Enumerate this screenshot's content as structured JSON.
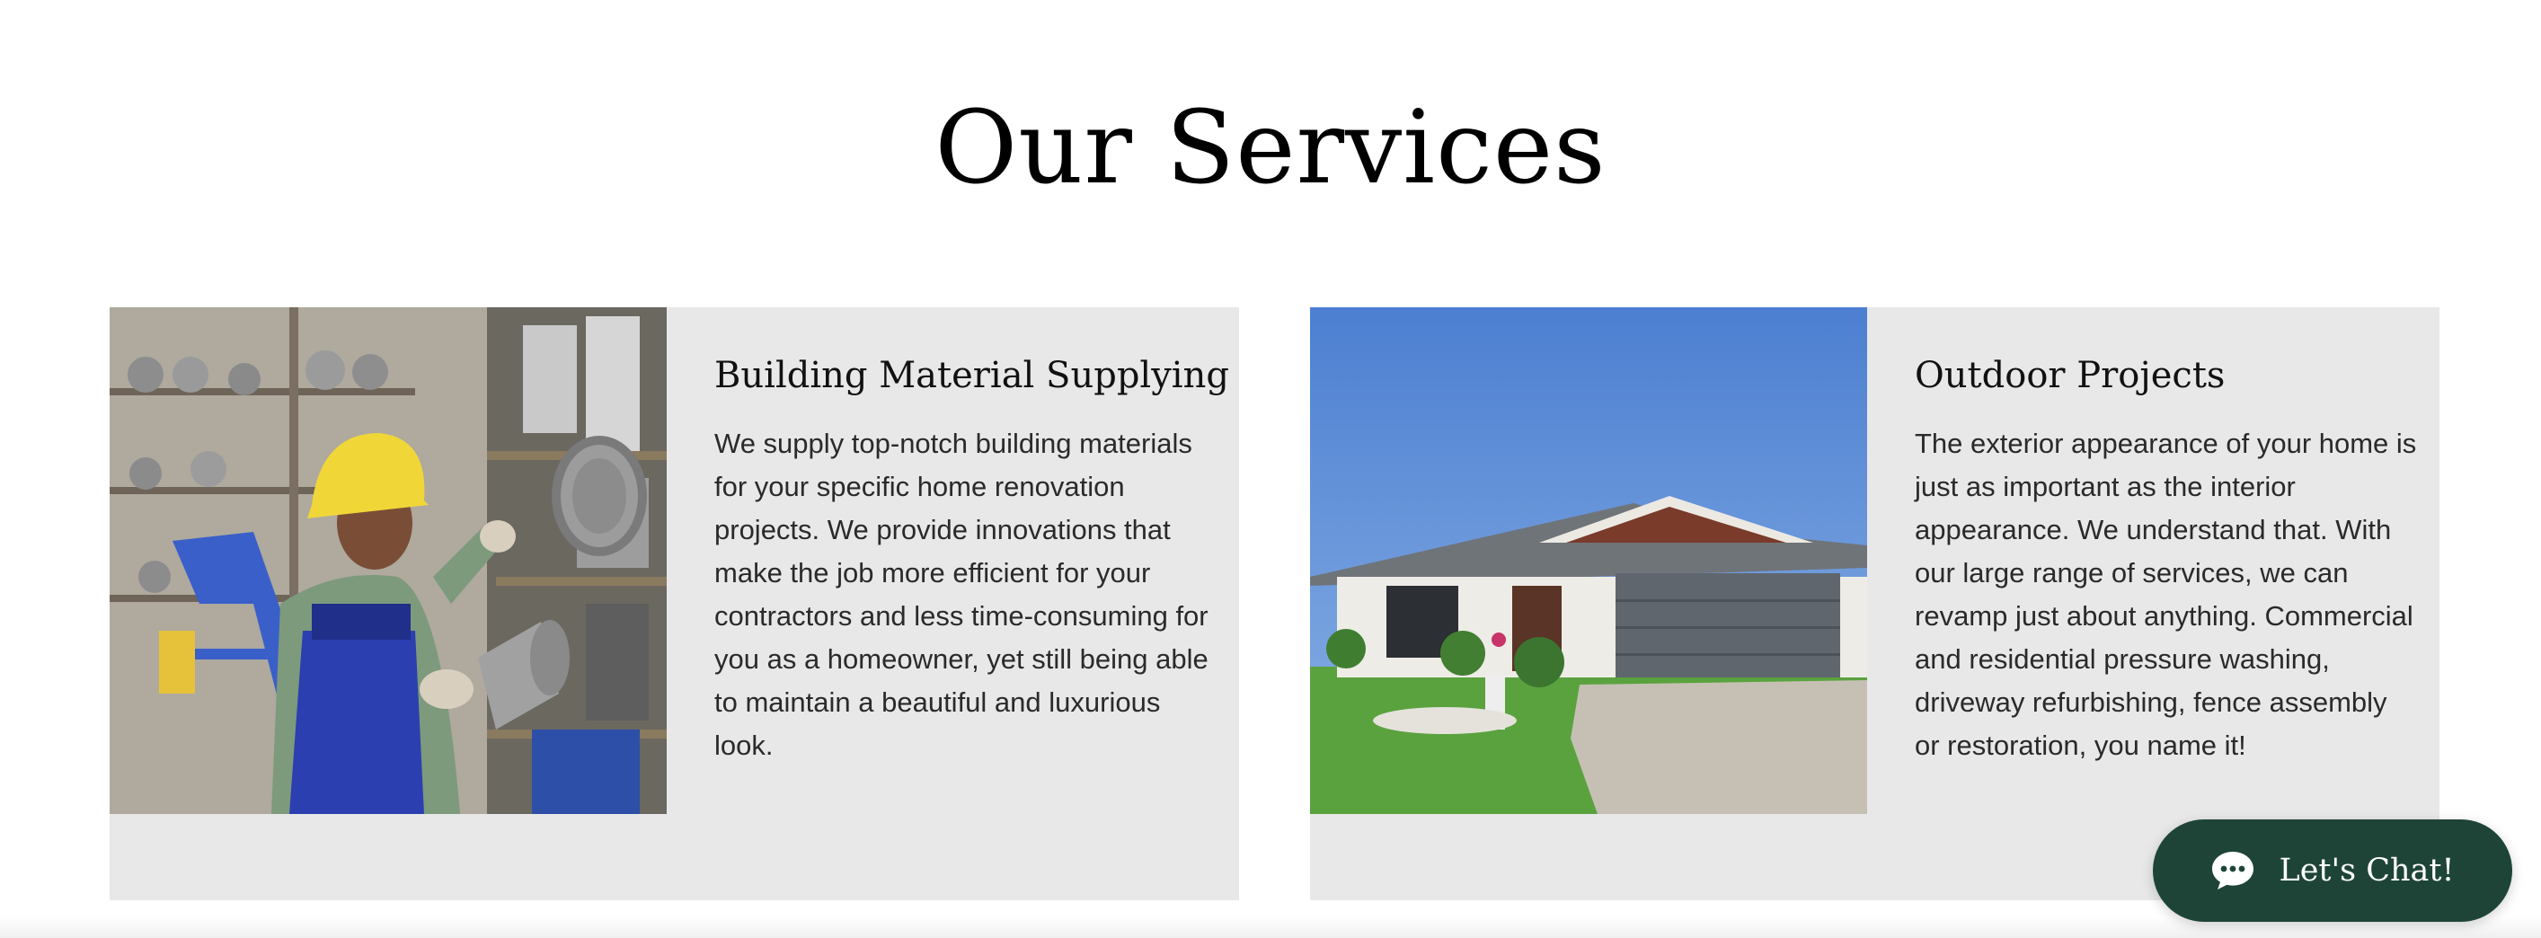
{
  "page": {
    "title": "Our Services"
  },
  "services": [
    {
      "heading": "Building Material Supplying",
      "description": "We supply top-notch building materials for your specific home renovation projects. We provide innovations that make the job more efficient for your contractors and less time-consuming for you as a homeowner, yet still being able to maintain a beautiful and luxurious look.",
      "image_icon": "worker-with-pipes-photo"
    },
    {
      "heading": "Outdoor Projects",
      "description": "The exterior appearance of your home is just as important as the interior appearance. We understand that. With our large range of services, we can revamp just about anything. Commercial and residential pressure washing, driveway refurbishing, fence assembly or restoration, you name it!",
      "image_icon": "house-exterior-photo"
    }
  ],
  "chat": {
    "label": "Let's Chat!",
    "icon": "chat-bubble-icon",
    "background_color": "#1e4438"
  },
  "colors": {
    "card_background": "#e8e8e8",
    "page_background": "#ffffff"
  }
}
